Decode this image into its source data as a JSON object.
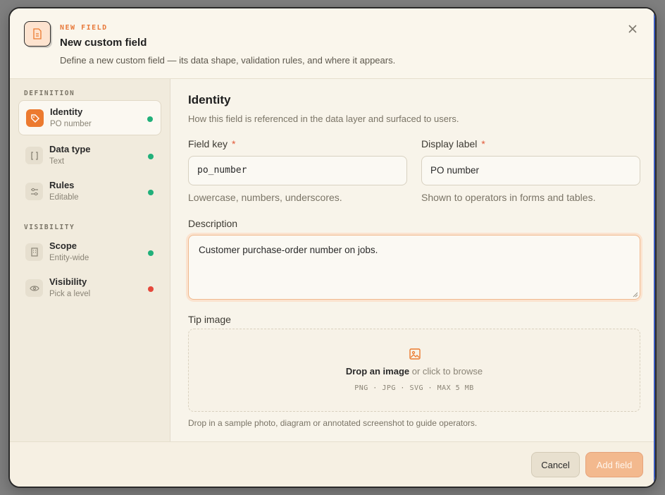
{
  "header": {
    "eyebrow": "NEW FIELD",
    "title": "New custom field",
    "subtitle": "Define a new custom field — its data shape, validation rules, and where it appears.",
    "close_icon": "close-icon"
  },
  "sidebar": {
    "sections": [
      {
        "label": "DEFINITION",
        "items": [
          {
            "label": "Identity",
            "sub": "PO number",
            "icon": "tag-icon",
            "status": "complete",
            "active": true
          },
          {
            "label": "Data type",
            "sub": "Text",
            "icon": "brackets-icon",
            "status": "complete",
            "active": false
          },
          {
            "label": "Rules",
            "sub": "Editable",
            "icon": "sliders-icon",
            "status": "complete",
            "active": false
          }
        ]
      },
      {
        "label": "VISIBILITY",
        "items": [
          {
            "label": "Scope",
            "sub": "Entity-wide",
            "icon": "building-icon",
            "status": "complete",
            "active": false
          },
          {
            "label": "Visibility",
            "sub": "Pick a level",
            "icon": "eye-icon",
            "status": "incomplete",
            "active": false
          }
        ]
      }
    ]
  },
  "main": {
    "heading": "Identity",
    "description": "How this field is referenced in the data layer and surfaced to users.",
    "field_key": {
      "label": "Field key",
      "required": "*",
      "value": "po_number",
      "hint": "Lowercase, numbers, underscores."
    },
    "display_label": {
      "label": "Display label",
      "required": "*",
      "value": "PO number",
      "hint": "Shown to operators in forms and tables."
    },
    "description_field": {
      "label": "Description",
      "value": "Customer purchase-order number on jobs."
    },
    "tip_image": {
      "label": "Tip image",
      "drop_bold": "Drop an image",
      "drop_rest": " or click to browse",
      "formats": "PNG · JPG · SVG · MAX 5 MB",
      "hint": "Drop in a sample photo, diagram or annotated screenshot to guide operators."
    }
  },
  "footer": {
    "cancel_label": "Cancel",
    "add_label": "Add field"
  },
  "colors": {
    "accent": "#ec7a2f",
    "complete": "#21b07a",
    "incomplete": "#e5483b"
  }
}
